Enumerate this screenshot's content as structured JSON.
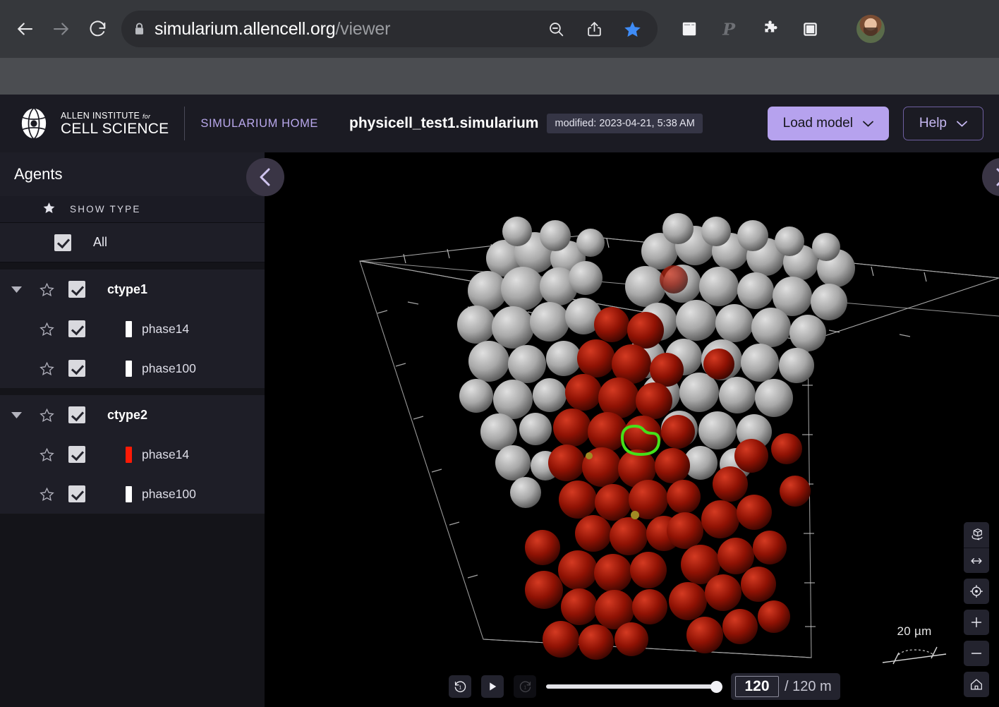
{
  "browser": {
    "back_icon": "arrow-left-icon",
    "forward_icon": "arrow-right-icon",
    "reload_icon": "reload-icon",
    "lock_icon": "lock-icon",
    "url_domain": "simularium.allencell.org",
    "url_path": "/viewer",
    "zoom_out_icon": "magnifier-minus-icon",
    "share_icon": "share-icon",
    "bookmark_icon": "star-filled-icon",
    "reader_icon": "reader-window-icon",
    "password_icon": "p-letter-icon",
    "extensions_icon": "puzzle-piece-icon",
    "sidebar_toggle_icon": "sidebar-panel-icon",
    "avatar_icon": "user-avatar"
  },
  "header": {
    "logo_line1": "ALLEN INSTITUTE ",
    "logo_for": "for",
    "logo_line2": "CELL SCIENCE",
    "home_link": "SIMULARIUM HOME",
    "file_name": "physicell_test1.simularium",
    "modified_badge": "modified: 2023-04-21, 5:38 AM",
    "load_model_label": "Load model",
    "help_label": "Help",
    "caret": "∨",
    "accent_purple": "#b6a2ee",
    "accent_link": "#b9a8ec"
  },
  "sidebar": {
    "title": "Agents",
    "show_type_label": "SHOW TYPE",
    "collapse_icon": "chevron-left-icon",
    "rows": [
      {
        "label": "All",
        "kind": "all",
        "checked": true,
        "swatch": null
      },
      {
        "label": "ctype1",
        "kind": "group",
        "checked": true,
        "swatch": null,
        "expanded": true
      },
      {
        "label": "phase14",
        "kind": "child",
        "checked": true,
        "swatch": "#ffffff"
      },
      {
        "label": "phase100",
        "kind": "child",
        "checked": true,
        "swatch": "#ffffff"
      },
      {
        "label": "ctype2",
        "kind": "group",
        "checked": true,
        "swatch": null,
        "expanded": true
      },
      {
        "label": "phase14",
        "kind": "child",
        "checked": true,
        "swatch": "#fc1a06"
      },
      {
        "label": "phase100",
        "kind": "child",
        "checked": true,
        "swatch": "#ffffff"
      }
    ]
  },
  "viewport": {
    "right_collapse_icon": "chevron-right-icon",
    "scale_label": "20 µm",
    "background": "#000000",
    "agent_colors": {
      "ctype1": "#b0b0b0",
      "ctype2": "#9a1306",
      "selection_outline": "#45e019"
    },
    "controls": [
      {
        "name": "orbit-camera-button",
        "icon": "orbit-cube-icon"
      },
      {
        "name": "pan-camera-button",
        "icon": "pan-arrows-icon"
      },
      {
        "name": "focus-camera-button",
        "icon": "crosshair-target-icon"
      },
      {
        "name": "zoom-in-button",
        "icon": "plus-icon"
      },
      {
        "name": "zoom-out-button",
        "icon": "minus-icon"
      },
      {
        "name": "reset-camera-button",
        "icon": "home-icon"
      }
    ]
  },
  "playback": {
    "skip_back_icon": "skip-back-icon",
    "play_icon": "play-icon",
    "skip_forward_icon": "skip-forward-icon",
    "progress_percent": 100,
    "current_time": "120",
    "total_time": "/ 120 m"
  }
}
